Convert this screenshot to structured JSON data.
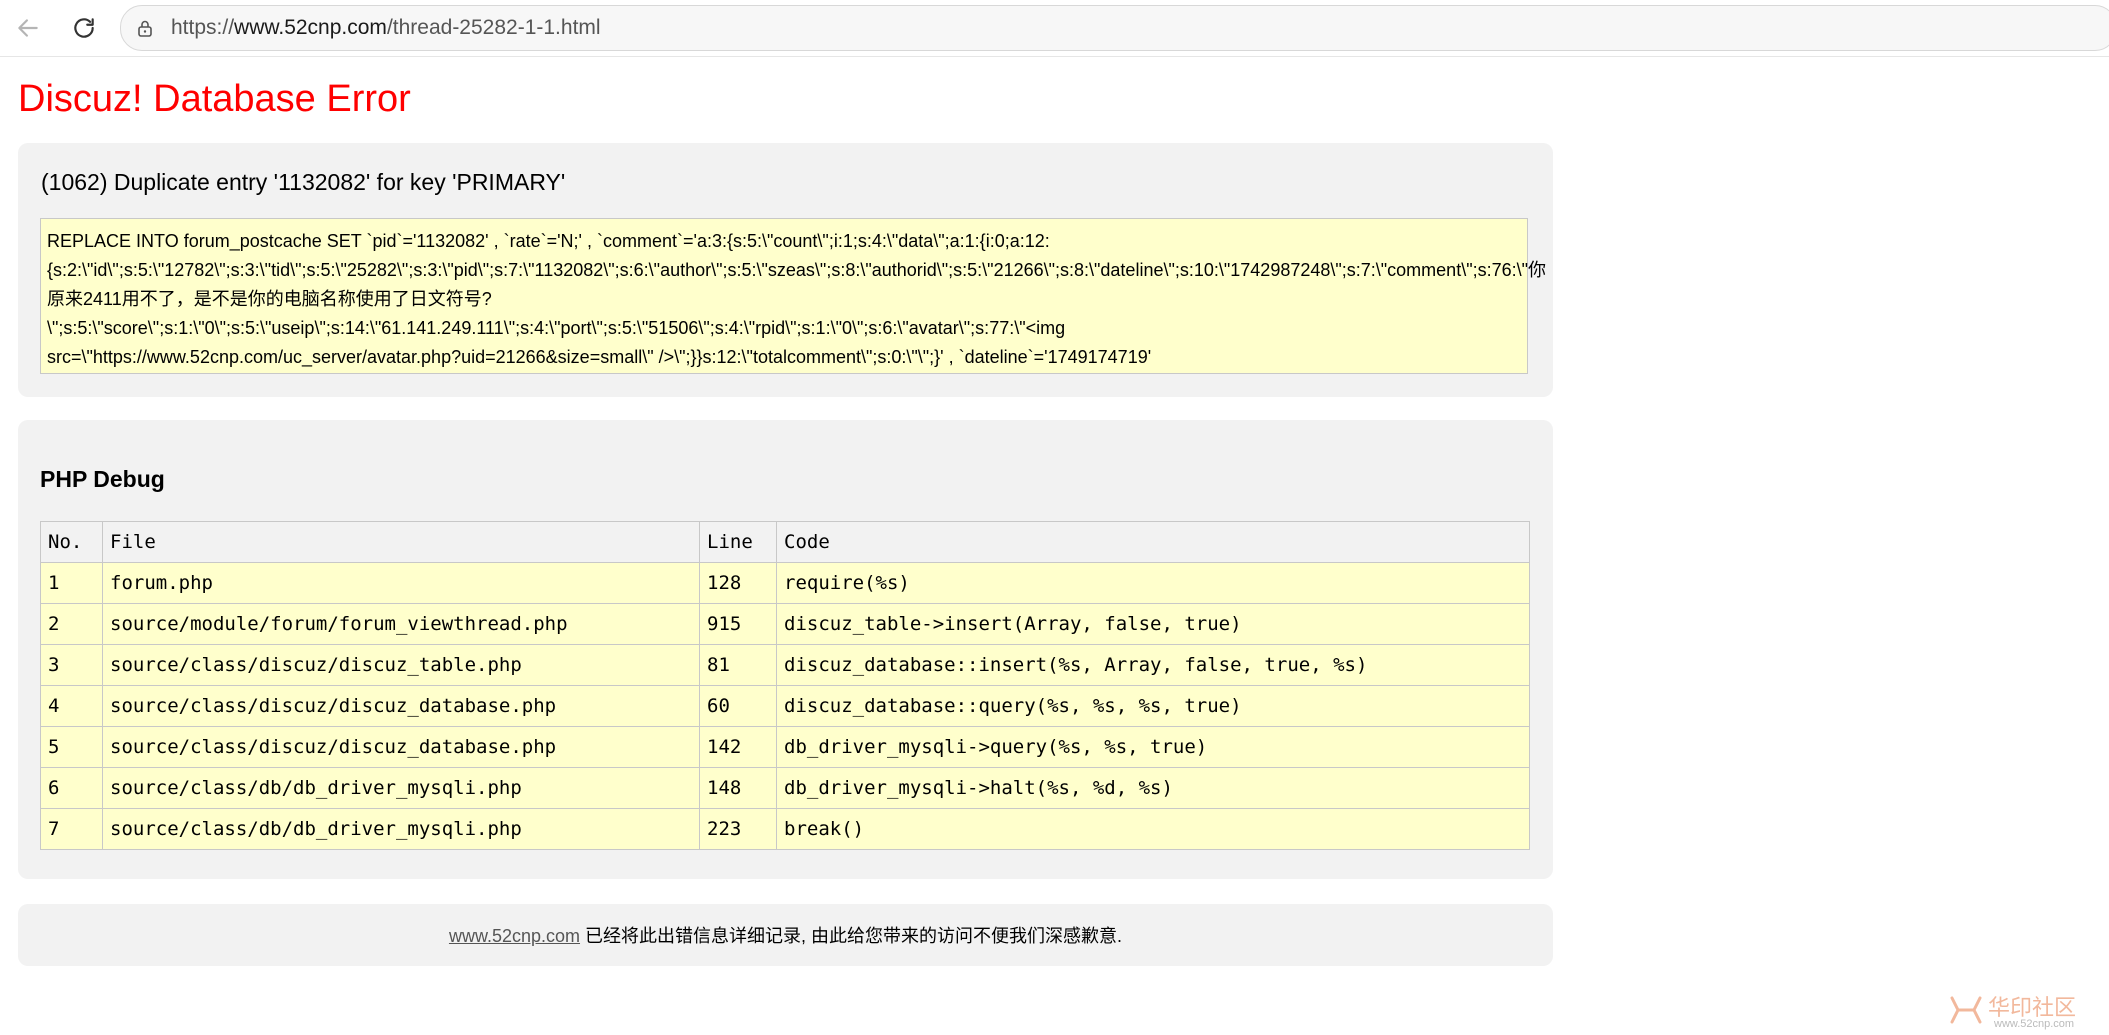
{
  "browser": {
    "url_scheme": "https://",
    "url_host": "www.52cnp.com",
    "url_path": "/thread-25282-1-1.html"
  },
  "page": {
    "title": "Discuz! Database Error"
  },
  "error": {
    "message": "(1062) Duplicate entry '1132082' for key 'PRIMARY'",
    "sql_lines": [
      "REPLACE INTO forum_postcache SET `pid`='1132082' , `rate`='N;' , `comment`='a:3:{s:5:\\\"count\\\";i:1;s:4:\\\"data\\\";a:1:{i:0;a:12:",
      "{s:2:\\\"id\\\";s:5:\\\"12782\\\";s:3:\\\"tid\\\";s:5:\\\"25282\\\";s:3:\\\"pid\\\";s:7:\\\"1132082\\\";s:6:\\\"author\\\";s:5:\\\"szeas\\\";s:8:\\\"authorid\\\";s:5:\\\"21266\\\";s:8:\\\"dateline\\\";s:10:\\\"1742987248\\\";s:7:\\\"comment\\\";s:76:\\\"你",
      "原来2411用不了，是不是你的电脑名称使用了日文符号?",
      "\\\";s:5:\\\"score\\\";s:1:\\\"0\\\";s:5:\\\"useip\\\";s:14:\\\"61.141.249.111\\\";s:4:\\\"port\\\";s:5:\\\"51506\\\";s:4:\\\"rpid\\\";s:1:\\\"0\\\";s:6:\\\"avatar\\\";s:77:\\\"<img",
      "src=\\\"https://www.52cnp.com/uc_server/avatar.php?uid=21266&size=small\\\" />\\\";}}s:12:\\\"totalcomment\\\";s:0:\\\"\\\";}' , `dateline`='1749174719'"
    ]
  },
  "debug": {
    "heading": "PHP Debug",
    "columns": [
      "No.",
      "File",
      "Line",
      "Code"
    ],
    "rows": [
      [
        "1",
        "forum.php",
        "128",
        "require(%s)"
      ],
      [
        "2",
        "source/module/forum/forum_viewthread.php",
        "915",
        "discuz_table->insert(Array, false, true)"
      ],
      [
        "3",
        "source/class/discuz/discuz_table.php",
        "81",
        "discuz_database::insert(%s, Array, false, true, %s)"
      ],
      [
        "4",
        "source/class/discuz/discuz_database.php",
        "60",
        "discuz_database::query(%s, %s, %s, true)"
      ],
      [
        "5",
        "source/class/discuz/discuz_database.php",
        "142",
        "db_driver_mysqli->query(%s, %s, true)"
      ],
      [
        "6",
        "source/class/db/db_driver_mysqli.php",
        "148",
        "db_driver_mysqli->halt(%s, %d, %s)"
      ],
      [
        "7",
        "source/class/db/db_driver_mysqli.php",
        "223",
        "break()"
      ]
    ]
  },
  "footer": {
    "link": "www.52cnp.com",
    "text": " 已经将此出错信息详细记录, 由此给您带来的访问不便我们深感歉意."
  },
  "watermark": {
    "text": "华印社区",
    "sub": "www.52cnp.com"
  }
}
